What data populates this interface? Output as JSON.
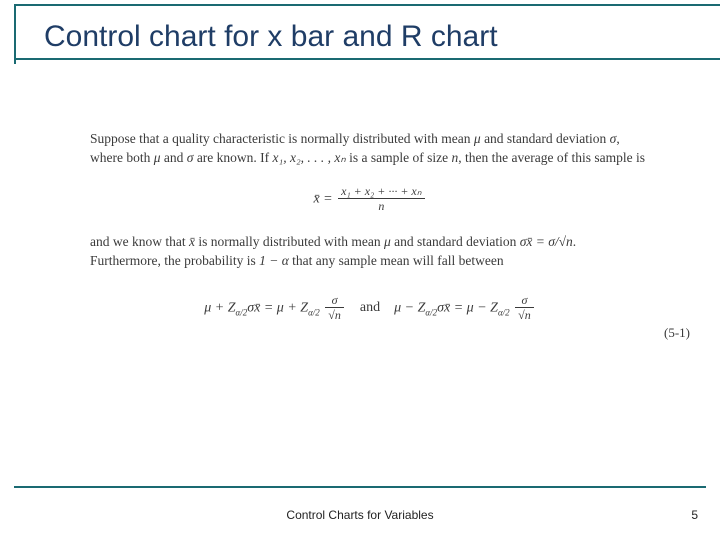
{
  "title": "Control chart for x bar and R chart",
  "para1_a": "Suppose that a quality characteristic is normally distributed with mean ",
  "para1_b": " and standard deviation ",
  "para1_c": ", where both ",
  "para1_d": " and ",
  "para1_e": " are known. If ",
  "para1_f": " is a sample of size ",
  "para1_g": ", then the average of this sample is",
  "mu": "μ",
  "sigma": "σ",
  "sample_list": "x₁, x₂, . . . , xₙ",
  "n": "n",
  "eq1_lhs": "x̄ = ",
  "eq1_num": "x₁ + x₂ + ··· + xₙ",
  "eq1_den": "n",
  "para2_a": "and we know that ",
  "para2_b": " is normally distributed with mean ",
  "para2_c": " and standard deviation ",
  "para2_d": ". Furthermore, the probability is ",
  "para2_e": " that any sample mean will fall between",
  "xbar": "x̄",
  "sigma_xbar": "σx̄ = σ/√n",
  "one_minus_alpha": "1 − α",
  "eq2_left_a": "μ + Z",
  "eq2_sub": "α/2",
  "eq2_left_b": "σx̄ = μ + Z",
  "eq2_frac_num": "σ",
  "eq2_frac_den": "√n",
  "eq2_and": "and",
  "eq2_right_a": "μ − Z",
  "eq2_right_b": "σx̄ = μ − Z",
  "eq_num": "(5-1)",
  "footer": "Control Charts for Variables",
  "page": "5"
}
